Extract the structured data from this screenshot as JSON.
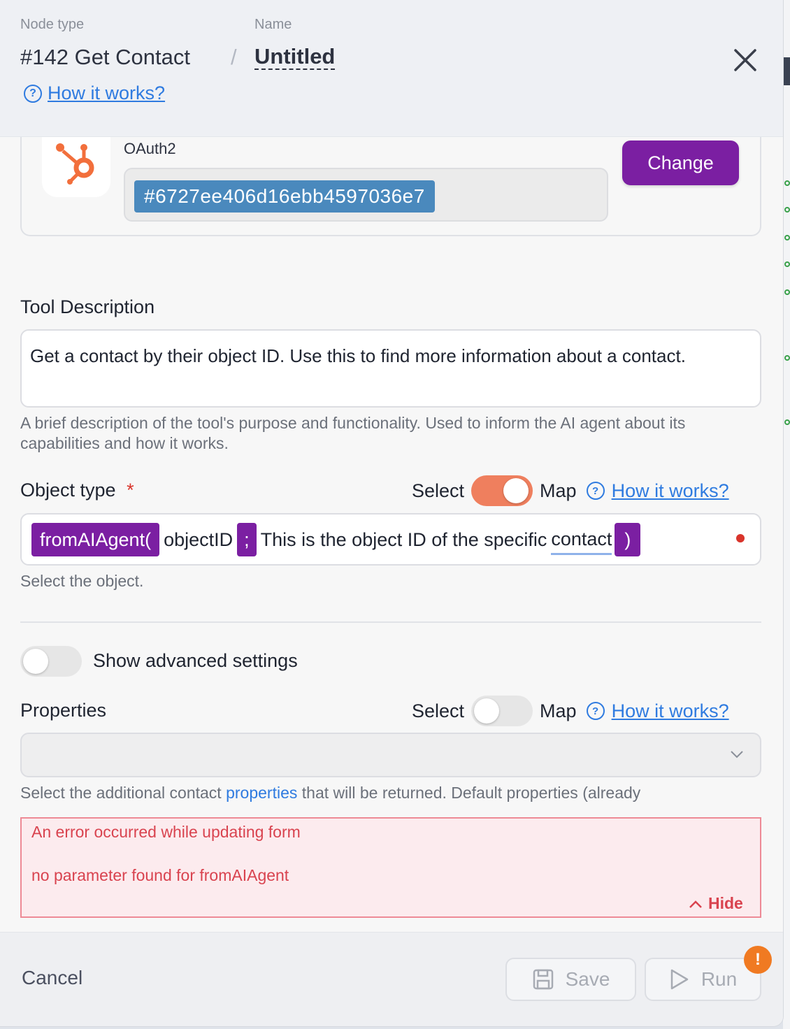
{
  "header": {
    "node_type_label": "Node type",
    "name_label": "Name",
    "node_title": "#142 Get Contact",
    "separator": "/",
    "name_value": "Untitled",
    "how_it_works": "How it works?"
  },
  "credential": {
    "auth_label": "OAuth2",
    "connection_id": "#6727ee406d16ebb4597036e7",
    "change_label": "Change",
    "logo_icon": "hubspot-icon",
    "brand_color": "#f26f3c"
  },
  "tool_description": {
    "label": "Tool Description",
    "value": "Get a contact by their object ID. Use this to find more information about a contact.",
    "help": "A brief description of the tool's purpose and functionality. Used to inform the AI agent about its capabilities and how it works."
  },
  "object_type": {
    "label": "Object type",
    "required_mark": "*",
    "select_label": "Select",
    "map_label": "Map",
    "mode_map_on": true,
    "how_it_works": "How it works?",
    "chip_open": "fromAIAgent(",
    "param_name": "objectID",
    "chip_sep": ";",
    "param_desc_prefix": "This is the object ID of the specific",
    "param_desc_underlined": "contact",
    "chip_close": ")",
    "help": "Select the object."
  },
  "advanced": {
    "label": "Show advanced settings",
    "enabled": false
  },
  "properties": {
    "label": "Properties",
    "select_label": "Select",
    "map_label": "Map",
    "mode_map_on": false,
    "how_it_works": "How it works?",
    "selected_value": "",
    "help_prefix": "Select the additional contact",
    "help_link": "properties",
    "help_suffix": "that will be returned. Default properties (already"
  },
  "error": {
    "title": "An error occurred while updating form",
    "detail": "no parameter found for fromAIAgent",
    "hide_label": "Hide"
  },
  "footer": {
    "cancel_label": "Cancel",
    "save_label": "Save",
    "run_label": "Run",
    "warning_badge": "!"
  },
  "colors": {
    "accent_purple": "#7b1fa2",
    "toggle_on": "#ef7f5e",
    "link_blue": "#2f7be0",
    "error_red": "#d9434f",
    "warning_orange": "#f07a22"
  }
}
